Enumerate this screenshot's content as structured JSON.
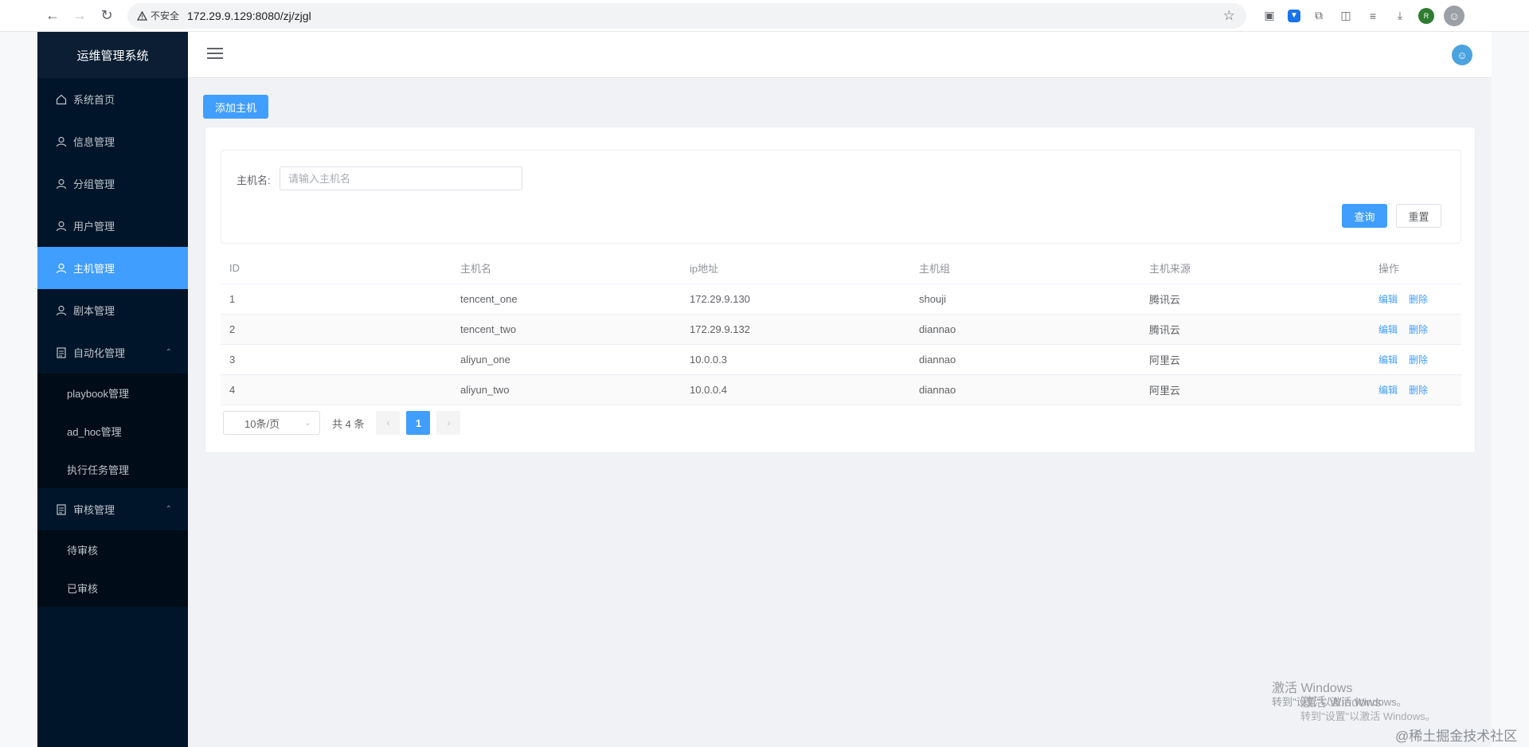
{
  "browser": {
    "insecure_label": "不安全",
    "url": "172.29.9.129:8080/zj/zjgl"
  },
  "sidebar": {
    "title": "运维管理系统",
    "items": [
      {
        "label": "系统首页"
      },
      {
        "label": "信息管理"
      },
      {
        "label": "分组管理"
      },
      {
        "label": "用户管理"
      },
      {
        "label": "主机管理"
      },
      {
        "label": "剧本管理"
      },
      {
        "label": "自动化管理"
      },
      {
        "label": "审核管理"
      }
    ],
    "automation_sub": [
      {
        "label": "playbook管理"
      },
      {
        "label": "ad_hoc管理"
      },
      {
        "label": "执行任务管理"
      }
    ],
    "audit_sub": [
      {
        "label": "待审核"
      },
      {
        "label": "已审核"
      }
    ]
  },
  "main": {
    "add_button": "添加主机",
    "search": {
      "label": "主机名:",
      "placeholder": "请输入主机名",
      "query_button": "查询",
      "reset_button": "重置"
    },
    "table": {
      "columns": [
        "ID",
        "主机名",
        "ip地址",
        "主机组",
        "主机来源",
        "操作"
      ],
      "rows": [
        {
          "id": "1",
          "name": "tencent_one",
          "ip": "172.29.9.130",
          "group": "shouji",
          "source": "腾讯云"
        },
        {
          "id": "2",
          "name": "tencent_two",
          "ip": "172.29.9.132",
          "group": "diannao",
          "source": "腾讯云"
        },
        {
          "id": "3",
          "name": "aliyun_one",
          "ip": "10.0.0.3",
          "group": "diannao",
          "source": "阿里云"
        },
        {
          "id": "4",
          "name": "aliyun_two",
          "ip": "10.0.0.4",
          "group": "diannao",
          "source": "阿里云"
        }
      ],
      "edit_label": "编辑",
      "delete_label": "删除"
    },
    "pagination": {
      "page_size": "10条/页",
      "total": "共 4 条",
      "current_page": "1"
    }
  },
  "overlay": {
    "activate_title": "激活 Windows",
    "activate_sub": "转到\"设置\"以激活 Windows。",
    "juejin": "@稀土掘金技术社区"
  },
  "colors": {
    "primary": "#409eff",
    "sidebar_bg": "#001529"
  }
}
